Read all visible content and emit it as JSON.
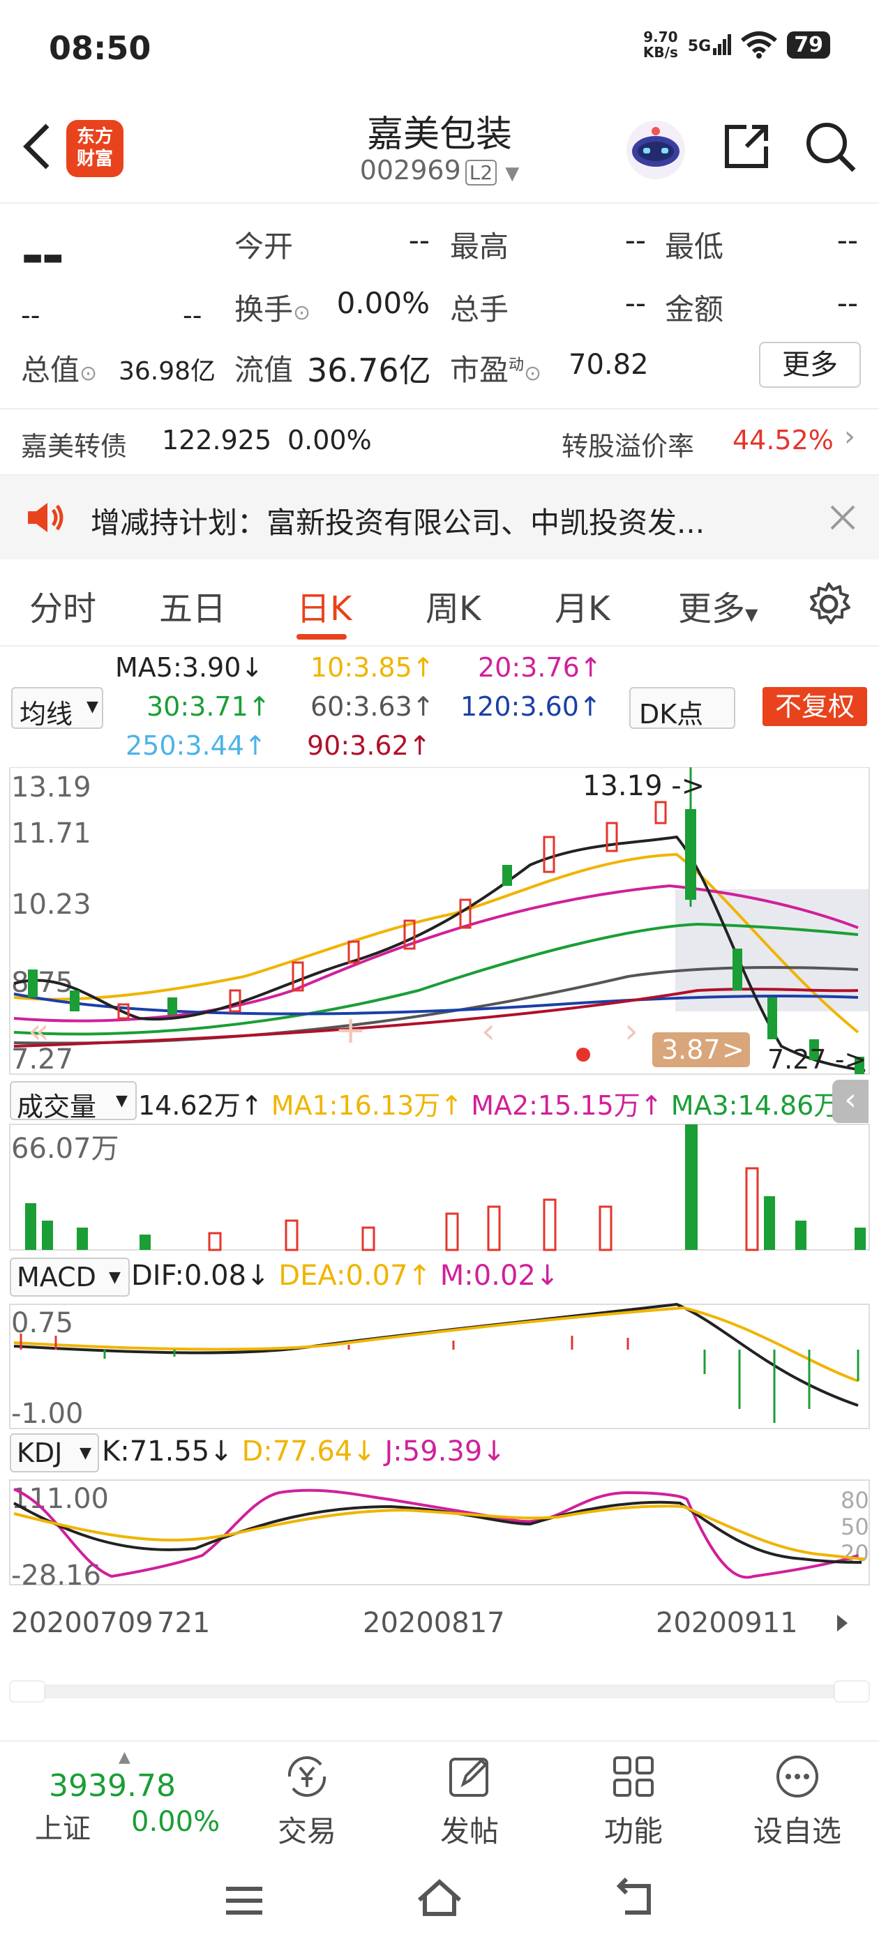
{
  "status_bar": {
    "time": "08:50",
    "net_speed": "9.70",
    "net_unit": "KB/s",
    "signal": "5G",
    "battery": "79"
  },
  "header": {
    "logo_line1": "东方",
    "logo_line2": "财富",
    "stock_name": "嘉美包装",
    "stock_code": "002969",
    "level_tag": "L2"
  },
  "quote": {
    "price": "--",
    "change": "--",
    "change_pct": "--",
    "open_label": "今开",
    "open": "--",
    "high_label": "最高",
    "high": "--",
    "low_label": "最低",
    "low": "--",
    "turnover_label": "换手",
    "turnover": "0.00%",
    "volume_label": "总手",
    "volume": "--",
    "amount_label": "金额",
    "amount": "--",
    "mktcap_label": "总值",
    "mktcap": "36.98亿",
    "float_label": "流值",
    "float_cap": "36.76亿",
    "pe_label": "市盈",
    "pe_sup": "动",
    "pe": "70.82",
    "more_label": "更多"
  },
  "convertible": {
    "name": "嘉美转债",
    "price": "122.925",
    "change": "0.00%",
    "premium_label": "转股溢价率",
    "premium": "44.52%"
  },
  "notice": {
    "text": "增减持计划：富新投资有限公司、中凯投资发..."
  },
  "tabs": [
    "分时",
    "五日",
    "日K",
    "周K",
    "月K",
    "更多"
  ],
  "active_tab": "日K",
  "ma": {
    "selector": "均线",
    "ma5": "MA5:3.90",
    "ma10": "10:3.85",
    "ma20": "20:3.76",
    "ma30": "30:3.71",
    "ma60": "60:3.63",
    "ma120": "120:3.60",
    "ma250": "250:3.44",
    "ma90": "90:3.62",
    "dk_label": "DK点",
    "fq_label": "不复权"
  },
  "colors": {
    "up": "#e5352b",
    "down": "#1a9e35",
    "accent": "#e8431d",
    "ma5": "#222222",
    "ma10": "#f0b400",
    "ma20": "#d0209a",
    "ma30": "#1a9e35",
    "ma60": "#555555",
    "ma120": "#1b3fa8",
    "ma250": "#4cb3e8",
    "ma90": "#b0102a"
  },
  "kline": {
    "y_labels": [
      "13.19",
      "11.71",
      "10.23",
      "8.75",
      "7.27"
    ],
    "max_label": "13.19",
    "min_label": "7.27",
    "price_tag": "3.87"
  },
  "volume_panel": {
    "selector": "成交量",
    "vol": "14.62万",
    "ma1": "MA1:16.13万",
    "ma2": "MA2:15.15万",
    "ma3": "MA3:14.86万",
    "y_label": "66.07万"
  },
  "macd_panel": {
    "selector": "MACD",
    "dif": "DIF:0.08",
    "dea": "DEA:0.07",
    "m": "M:0.02",
    "y_top": "0.75",
    "y_bottom": "-1.00"
  },
  "kdj_panel": {
    "selector": "KDJ",
    "k": "K:71.55",
    "d": "D:77.64",
    "j": "J:59.39",
    "y_top": "111.00",
    "y_bottom": "-28.16",
    "levels": [
      "80",
      "50",
      "20"
    ]
  },
  "dates": [
    "20200709",
    "721",
    "20200817",
    "20200911"
  ],
  "bottom_nav": {
    "index_value": "3939.78",
    "index_name": "上证",
    "index_change": "0.00%",
    "trade": "交易",
    "post": "发帖",
    "func": "功能",
    "watch": "设自选"
  }
}
